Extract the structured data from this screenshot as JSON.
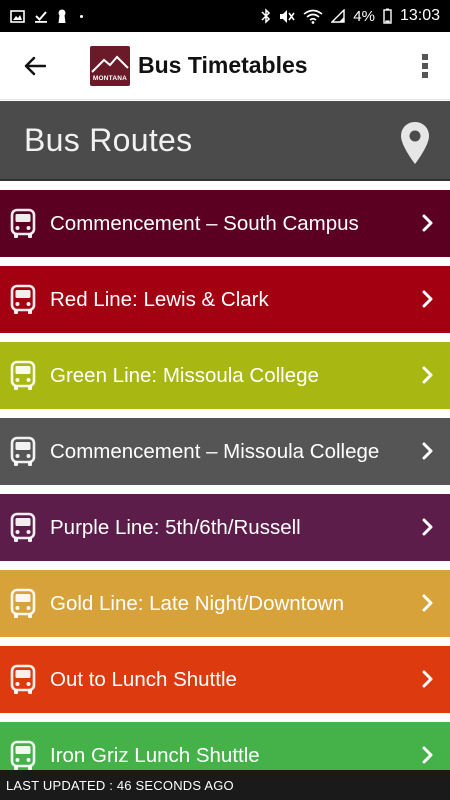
{
  "status_bar": {
    "battery": "4%",
    "time": "13:03"
  },
  "app_bar": {
    "logo_text": "MONTANA",
    "title": "Bus Timetables"
  },
  "header": {
    "title": "Bus Routes"
  },
  "routes": [
    {
      "label": "Commencement – South Campus",
      "color": "#5c0022"
    },
    {
      "label": "Red Line: Lewis & Clark",
      "color": "#a30012"
    },
    {
      "label": "Green Line: Missoula College",
      "color": "#a9b712"
    },
    {
      "label": "Commencement – Missoula College",
      "color": "#555555"
    },
    {
      "label": "Purple Line: 5th/6th/Russell",
      "color": "#5c1d4a"
    },
    {
      "label": "Gold Line: Late Night/Downtown",
      "color": "#d8a23a"
    },
    {
      "label": "Out to Lunch Shuttle",
      "color": "#dd3a10"
    },
    {
      "label": "Iron Griz Lunch Shuttle",
      "color": "#45b149"
    }
  ],
  "footer": {
    "last_updated": "LAST UPDATED : 46 SECONDS AGO"
  }
}
